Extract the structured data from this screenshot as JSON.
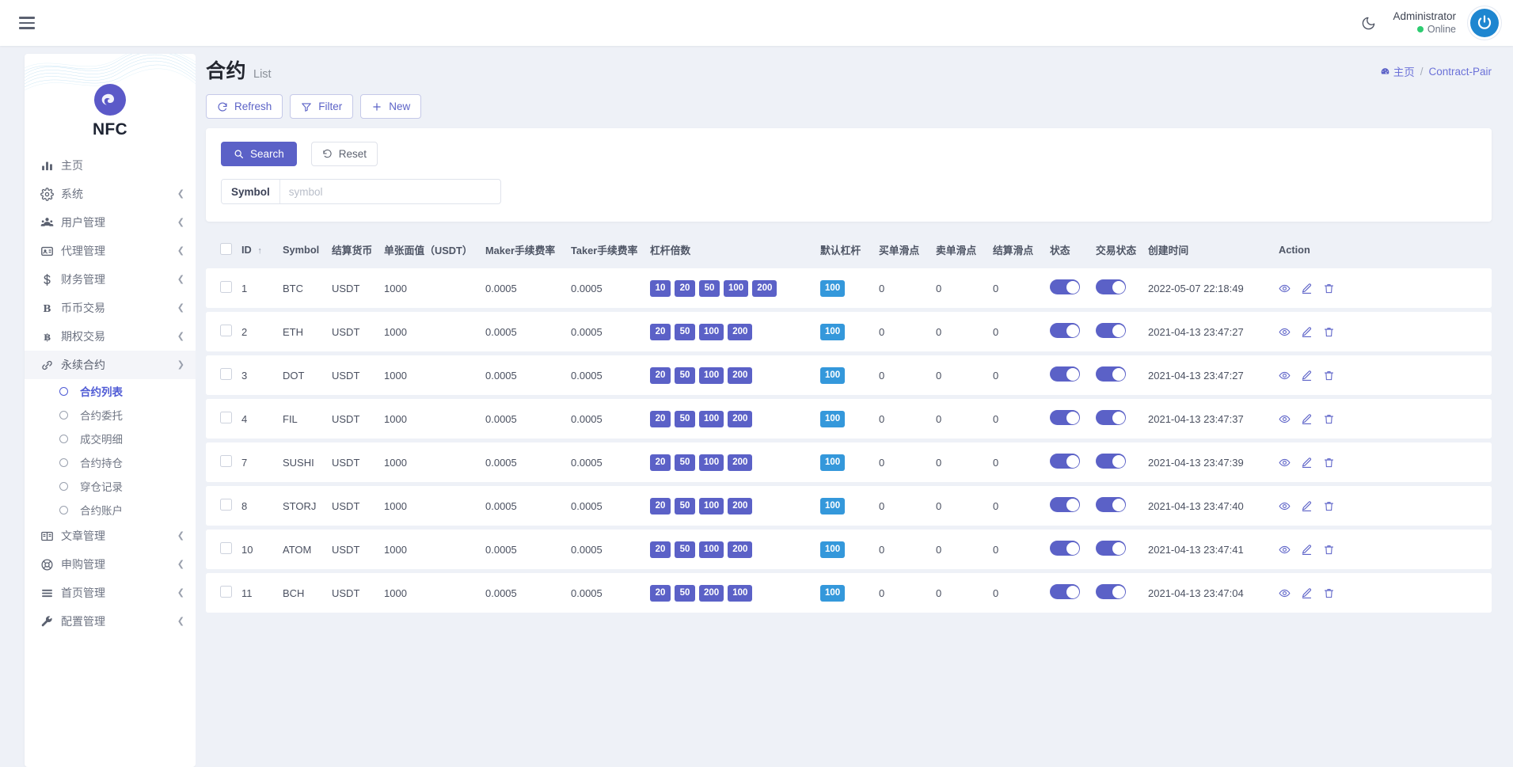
{
  "topbar": {
    "menu_icon": "hamburger-icon",
    "theme_icon": "moon-icon",
    "username": "Administrator",
    "status": "Online",
    "avatar_icon": "power-icon"
  },
  "sidebar": {
    "brand": "NFC",
    "items": [
      {
        "label": "主页",
        "icon": "chart-bar-icon",
        "expandable": false,
        "active": false
      },
      {
        "label": "系统",
        "icon": "gear-icon",
        "expandable": true,
        "active": false
      },
      {
        "label": "用户管理",
        "icon": "user-group-icon",
        "expandable": true,
        "active": false
      },
      {
        "label": "代理管理",
        "icon": "id-card-icon",
        "expandable": true,
        "active": false
      },
      {
        "label": "财务管理",
        "icon": "dollar-icon",
        "expandable": true,
        "active": false
      },
      {
        "label": "币币交易",
        "icon": "letter-b-icon",
        "expandable": true,
        "active": false
      },
      {
        "label": "期权交易",
        "icon": "bitcoin-icon",
        "expandable": true,
        "active": false
      },
      {
        "label": "永续合约",
        "icon": "link-icon",
        "expandable": true,
        "active": true
      }
    ],
    "sub_items": [
      {
        "label": "合约列表",
        "active": true
      },
      {
        "label": "合约委托",
        "active": false
      },
      {
        "label": "成交明细",
        "active": false
      },
      {
        "label": "合约持仓",
        "active": false
      },
      {
        "label": "穿仓记录",
        "active": false
      },
      {
        "label": "合约账户",
        "active": false
      }
    ],
    "items_after": [
      {
        "label": "文章管理",
        "icon": "book-icon",
        "expandable": true
      },
      {
        "label": "申购管理",
        "icon": "lifebuoy-icon",
        "expandable": true
      },
      {
        "label": "首页管理",
        "icon": "lines-icon",
        "expandable": true
      },
      {
        "label": "配置管理",
        "icon": "wrench-icon",
        "expandable": true
      }
    ]
  },
  "page": {
    "title": "合约",
    "subtitle": "List",
    "breadcrumb_home": "主页",
    "breadcrumb_home_icon": "dashboard-icon",
    "breadcrumb_sep": "/",
    "breadcrumb_current": "Contract-Pair"
  },
  "toolbar": {
    "refresh_label": "Refresh",
    "refresh_icon": "refresh-icon",
    "filter_label": "Filter",
    "filter_icon": "funnel-icon",
    "new_label": "New",
    "new_icon": "plus-icon"
  },
  "search": {
    "search_label": "Search",
    "search_icon": "search-icon",
    "reset_label": "Reset",
    "reset_icon": "undo-icon",
    "symbol_label": "Symbol",
    "symbol_value": "",
    "symbol_placeholder": "symbol"
  },
  "table": {
    "columns": [
      "ID",
      "Symbol",
      "结算货币",
      "单张面值（USDT）",
      "Maker手续费率",
      "Taker手续费率",
      "杠杆倍数",
      "默认杠杆",
      "买单滑点",
      "卖单滑点",
      "结算滑点",
      "状态",
      "交易状态",
      "创建时间",
      "Action"
    ],
    "sort_column": "ID",
    "sort_icon": "arrow-up-icon",
    "action_icons": [
      "eye-icon",
      "pencil-icon",
      "trash-icon"
    ],
    "rows": [
      {
        "id": "1",
        "symbol": "BTC",
        "currency": "USDT",
        "face_value": "1000",
        "maker_fee": "0.0005",
        "taker_fee": "0.0005",
        "leverages": [
          "10",
          "20",
          "50",
          "100",
          "200"
        ],
        "default_leverage": "100",
        "buy_slip": "0",
        "sell_slip": "0",
        "settle_slip": "0",
        "status_on": true,
        "trade_status_on": true,
        "created_at": "2022-05-07 22:18:49"
      },
      {
        "id": "2",
        "symbol": "ETH",
        "currency": "USDT",
        "face_value": "1000",
        "maker_fee": "0.0005",
        "taker_fee": "0.0005",
        "leverages": [
          "20",
          "50",
          "100",
          "200"
        ],
        "default_leverage": "100",
        "buy_slip": "0",
        "sell_slip": "0",
        "settle_slip": "0",
        "status_on": true,
        "trade_status_on": true,
        "created_at": "2021-04-13 23:47:27"
      },
      {
        "id": "3",
        "symbol": "DOT",
        "currency": "USDT",
        "face_value": "1000",
        "maker_fee": "0.0005",
        "taker_fee": "0.0005",
        "leverages": [
          "20",
          "50",
          "100",
          "200"
        ],
        "default_leverage": "100",
        "buy_slip": "0",
        "sell_slip": "0",
        "settle_slip": "0",
        "status_on": true,
        "trade_status_on": true,
        "created_at": "2021-04-13 23:47:27"
      },
      {
        "id": "4",
        "symbol": "FIL",
        "currency": "USDT",
        "face_value": "1000",
        "maker_fee": "0.0005",
        "taker_fee": "0.0005",
        "leverages": [
          "20",
          "50",
          "100",
          "200"
        ],
        "default_leverage": "100",
        "buy_slip": "0",
        "sell_slip": "0",
        "settle_slip": "0",
        "status_on": true,
        "trade_status_on": true,
        "created_at": "2021-04-13 23:47:37"
      },
      {
        "id": "7",
        "symbol": "SUSHI",
        "currency": "USDT",
        "face_value": "1000",
        "maker_fee": "0.0005",
        "taker_fee": "0.0005",
        "leverages": [
          "20",
          "50",
          "100",
          "200"
        ],
        "default_leverage": "100",
        "buy_slip": "0",
        "sell_slip": "0",
        "settle_slip": "0",
        "status_on": true,
        "trade_status_on": true,
        "created_at": "2021-04-13 23:47:39"
      },
      {
        "id": "8",
        "symbol": "STORJ",
        "currency": "USDT",
        "face_value": "1000",
        "maker_fee": "0.0005",
        "taker_fee": "0.0005",
        "leverages": [
          "20",
          "50",
          "100",
          "200"
        ],
        "default_leverage": "100",
        "buy_slip": "0",
        "sell_slip": "0",
        "settle_slip": "0",
        "status_on": true,
        "trade_status_on": true,
        "created_at": "2021-04-13 23:47:40"
      },
      {
        "id": "10",
        "symbol": "ATOM",
        "currency": "USDT",
        "face_value": "1000",
        "maker_fee": "0.0005",
        "taker_fee": "0.0005",
        "leverages": [
          "20",
          "50",
          "100",
          "200"
        ],
        "default_leverage": "100",
        "buy_slip": "0",
        "sell_slip": "0",
        "settle_slip": "0",
        "status_on": true,
        "trade_status_on": true,
        "created_at": "2021-04-13 23:47:41"
      },
      {
        "id": "11",
        "symbol": "BCH",
        "currency": "USDT",
        "face_value": "1000",
        "maker_fee": "0.0005",
        "taker_fee": "0.0005",
        "leverages": [
          "20",
          "50",
          "200",
          "100"
        ],
        "default_leverage": "100",
        "buy_slip": "0",
        "sell_slip": "0",
        "settle_slip": "0",
        "status_on": true,
        "trade_status_on": true,
        "created_at": "2021-04-13 23:47:04"
      }
    ]
  },
  "colors": {
    "accent": "#5b61c7",
    "accent_light": "#3498db",
    "page_bg": "#eef1f7",
    "online": "#2ecc71",
    "avatar": "#1e86d0"
  }
}
